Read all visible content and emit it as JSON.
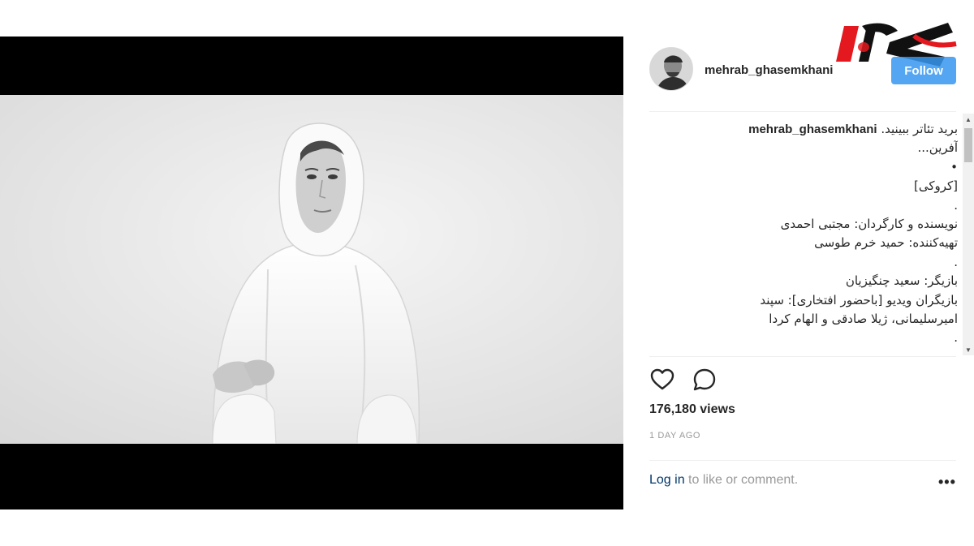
{
  "post": {
    "username": "mehrab_ghasemkhani",
    "follow_label": "Follow",
    "caption_user": "mehrab_ghasemkhani",
    "caption_lines": [
      "برید تئاتر ببینید.",
      "آفرین...",
      "•",
      "[کروکی]",
      ".",
      "نویسنده و کارگردان: مجتبی احمدی",
      "تهیه‌کننده: حمید خرم طوسی",
      ".",
      "بازیگر: سعید چنگیزیان",
      "بازیگران ویدیو [باحضور افتخاری]: سپند",
      "امیرسلیمانی، ژیلا صادقی و الهام کردا",
      "."
    ],
    "views": "176,180 views",
    "timestamp": "1 DAY AGO",
    "login_link": "Log in",
    "login_rest": " to like or comment.",
    "more_label": "•••"
  },
  "icons": {
    "like": "heart-icon",
    "comment": "speech-bubble-icon",
    "more": "more-options-icon"
  },
  "colors": {
    "follow_blue": "#3897f0",
    "link_navy": "#003569",
    "muted": "#999999",
    "text": "#262626",
    "logo_red": "#e3191f"
  }
}
